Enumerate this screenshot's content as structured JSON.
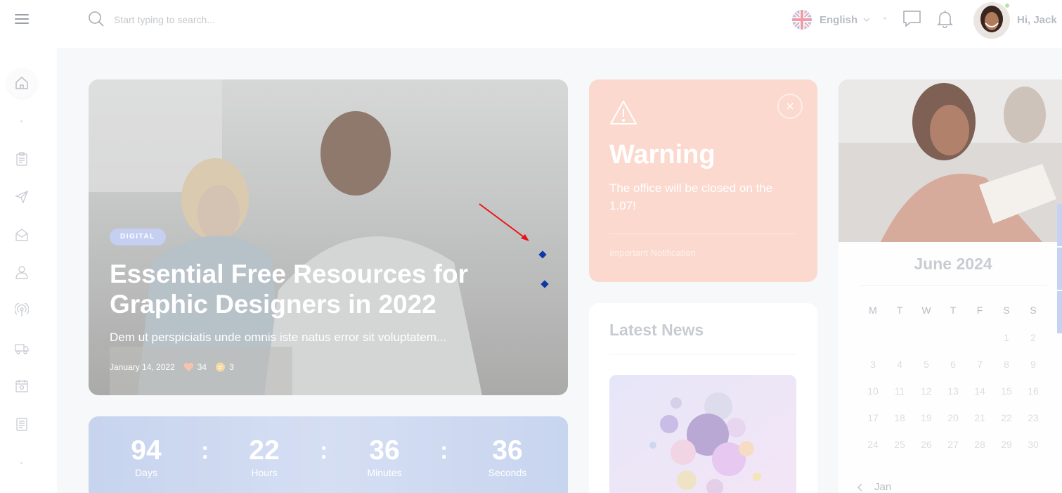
{
  "header": {
    "search_placeholder": "Start typing to search...",
    "language": "English",
    "greeting": "Hi,  Jack"
  },
  "sidebar": {
    "items": [
      "home-icon",
      "clipboard-icon",
      "send-icon",
      "mail-icon",
      "user-icon",
      "broadcast-icon",
      "truck-icon",
      "calendar-icon",
      "document-icon"
    ]
  },
  "hero": {
    "tag": "DIGITAL",
    "title": "Essential Free Resources for Graphic Designers in 2022",
    "excerpt": "Dem ut perspiciatis unde omnis iste natus error sit voluptatem...",
    "date": "January 14, 2022",
    "likes": "34",
    "comments": "3"
  },
  "countdown": {
    "days": "94",
    "days_label": "Days",
    "hours": "22",
    "hours_label": "Hours",
    "minutes": "36",
    "minutes_label": "Minutes",
    "seconds": "36",
    "seconds_label": "Seconds",
    "separator": ":"
  },
  "warning": {
    "title": "Warning",
    "message": "The office will be closed on the 1.07!",
    "footer": "Important Notification"
  },
  "news": {
    "title": "Latest News"
  },
  "calendar": {
    "month": "June 2024",
    "weekdays": [
      "M",
      "T",
      "W",
      "T",
      "F",
      "S",
      "S"
    ],
    "weeks": [
      [
        "",
        "",
        "",
        "",
        "",
        "1",
        "2"
      ],
      [
        "3",
        "4",
        "5",
        "6",
        "7",
        "8",
        "9"
      ],
      [
        "10",
        "11",
        "12",
        "13",
        "14",
        "15",
        "16"
      ],
      [
        "17",
        "18",
        "19",
        "20",
        "21",
        "22",
        "23"
      ],
      [
        "24",
        "25",
        "26",
        "27",
        "28",
        "29",
        "30"
      ]
    ],
    "prev_month": "Jan"
  },
  "colors": {
    "warning_bg": "#fbd9cf",
    "countdown_bg": "#c7d4ee",
    "tag_bg": "#c5cff2",
    "marker": "#0b3aa4",
    "arrow": "#e8141b"
  }
}
